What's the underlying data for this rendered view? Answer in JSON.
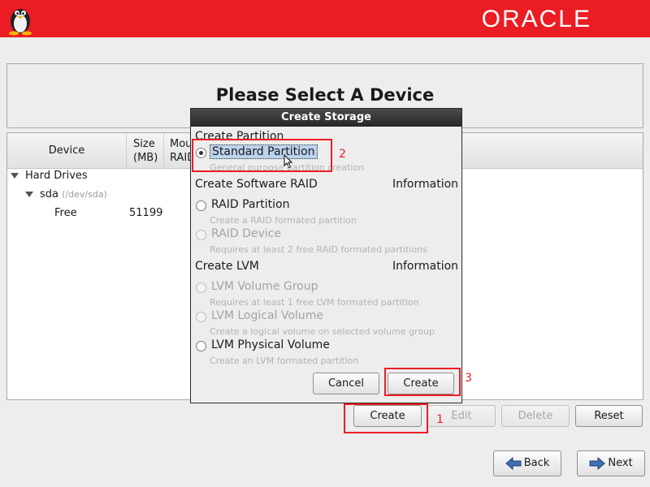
{
  "header": {
    "brand": "ORACLE",
    "logo_icon": "tux-penguin-icon",
    "accent_color": "#ec1c24"
  },
  "main": {
    "title": "Please Select A Device",
    "table": {
      "columns": [
        "Device",
        "Size (MB)",
        "Mou RAID"
      ],
      "col_size_l1": "Size",
      "col_size_l2": "(MB)",
      "col_mount_l1": "Mou",
      "col_mount_l2": "RAID",
      "group": "Hard Drives",
      "disk": {
        "name": "sda",
        "path": "(/dev/sda)"
      },
      "free_row": {
        "device": "Free",
        "size": "51199"
      }
    }
  },
  "actions": {
    "create": "Create",
    "edit": "Edit",
    "delete": "Delete",
    "reset": "Reset"
  },
  "nav": {
    "back": "Back",
    "next": "Next"
  },
  "dialog": {
    "title": "Create Storage",
    "sections": {
      "partition": "Create Partition",
      "raid": "Create Software RAID",
      "raid_info": "Information",
      "lvm": "Create LVM",
      "lvm_info": "Information"
    },
    "options": {
      "standard": {
        "label": "Standard Partition",
        "desc": "General purpose partition creation",
        "selected": true
      },
      "raid_partition": {
        "label": "RAID Partition",
        "desc": "Create a RAID formated partition"
      },
      "raid_device": {
        "label": "RAID Device",
        "desc": "Requires at least 2 free RAID formated partitions",
        "disabled": true
      },
      "lvm_vg": {
        "label": "LVM Volume Group",
        "desc": "Requires at least 1 free LVM formated partition",
        "disabled": true
      },
      "lvm_lv": {
        "label": "LVM Logical Volume",
        "desc": "Create a logical volume on selected volume group",
        "disabled": true
      },
      "lvm_pv": {
        "label": "LVM Physical Volume",
        "desc": "Create an LVM formated partition"
      }
    },
    "cancel": "Cancel",
    "create": "Create"
  },
  "annotations": {
    "step1": "1",
    "step2": "2",
    "step3": "3"
  }
}
